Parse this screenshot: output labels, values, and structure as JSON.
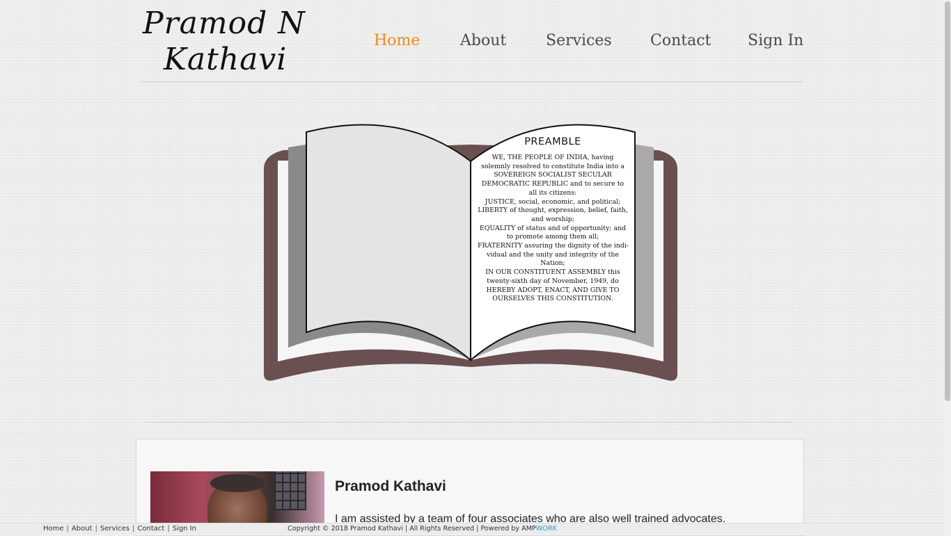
{
  "logo": {
    "line1": "Pramod N",
    "line2": "Kathavi"
  },
  "nav": {
    "home": "Home",
    "about": "About",
    "services": "Services",
    "contact": "Contact",
    "signin": "Sign In",
    "active_color": "#f28a1c"
  },
  "preamble": {
    "title": "PREAMBLE",
    "lines": [
      "WE, THE PEOPLE OF INDIA, having",
      "solemnly resolved to constitute India into a",
      "SOVEREIGN SOCIALIST SECULAR",
      "DEMOCRATIC REPUBLIC and to secure to",
      "all its citizens:",
      "JUSTICE, social, economic, and political;",
      "LIBERTY of thought, expression, belief, faith,",
      "and worship;",
      "EQUALITY of status and of opportunity; and",
      "to promote among them all;",
      "FRATERNITY assuring the dignity of the indi-",
      "vidual and the unity and integrity of the",
      "Nation;",
      "IN OUR CONSTITUENT ASSEMBLY this",
      "twenty-sixth day of November, 1949, do",
      "HEREBY ADOPT, ENACT, AND GIVE TO",
      "OURSELVES THIS CONSTITUTION."
    ]
  },
  "profile": {
    "name": "Pramod Kathavi",
    "intro": "I am assisted by a team of four associates who are also well trained advocates."
  },
  "footer": {
    "links": [
      "Home",
      "About",
      "Services",
      "Contact",
      "Sign In"
    ],
    "copyright": "Copyright © 2018 Pramod Kathavi | All Rights Reserved | Powered by",
    "brand_a": "AMP",
    "brand_b": "WORK"
  }
}
